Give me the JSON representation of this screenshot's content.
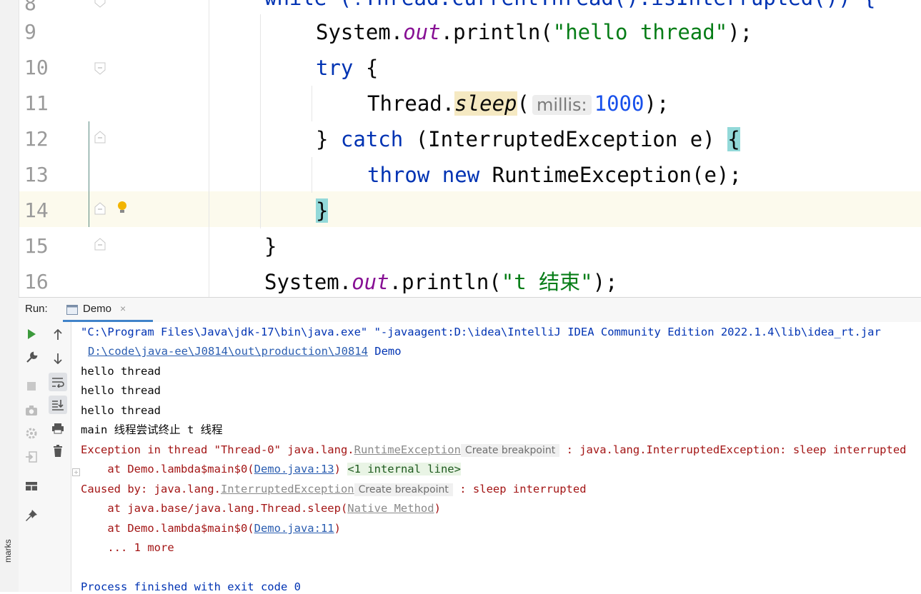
{
  "editor": {
    "line_numbers": [
      "8",
      "9",
      "10",
      "11",
      "12",
      "13",
      "14",
      "15",
      "16"
    ],
    "line8_partial": "while (!Thread.currentThread().isInterrupted()) {",
    "line9": {
      "obj": "System.",
      "field": "out",
      "call": ".println(",
      "str": "\"hello thread\"",
      "end": ");"
    },
    "line10": {
      "kw": "try",
      "rest": " {"
    },
    "line11": {
      "cls": "Thread.",
      "method": "sleep",
      "open": "(",
      "hint": "millis:",
      "num": "1000",
      "end": ");"
    },
    "line12": {
      "close": "} ",
      "kw": "catch",
      "params": " (InterruptedException e) ",
      "brace": "{"
    },
    "line13": {
      "kw1": "throw",
      "kw2": "new",
      "rest": " RuntimeException(e);"
    },
    "line14": {
      "brace": "}"
    },
    "line15": {
      "brace": "}"
    },
    "line16": {
      "obj": "System.",
      "field": "out",
      "call": ".println(",
      "str": "\"t 结束\"",
      "end": ");"
    }
  },
  "run_panel": {
    "label": "Run:",
    "tab": "Demo",
    "close": "×",
    "side_text": "marks"
  },
  "console": {
    "cmd1": "\"C:\\Program Files\\Java\\jdk-17\\bin\\java.exe\" \"-javaagent:D:\\idea\\IntelliJ IDEA Community Edition 2022.1.4\\lib\\idea_rt.jar",
    "cmd2_link": "D:\\code\\java-ee\\J0814\\out\\production\\J0814",
    "cmd2_rest": " Demo",
    "out1": "hello thread",
    "out2": "hello thread",
    "out3": "hello thread",
    "out4": "main 线程尝试终止 t 线程",
    "ex_prefix": "Exception in thread \"Thread-0\" java.lang.",
    "ex_class": "RuntimeException",
    "ex_bp": "Create breakpoint",
    "ex_msg": " : java.lang.InterruptedException: sleep interrupted",
    "at1_prefix": "    at Demo.lambda$main$0(",
    "at1_link": "Demo.java:13",
    "at1_close": ")",
    "at1_internal": "<1 internal line>",
    "cause_prefix": "Caused by: java.lang.",
    "cause_class": "InterruptedException",
    "cause_bp": "Create breakpoint",
    "cause_msg": " : sleep interrupted",
    "at2_prefix": "    at java.base/java.lang.Thread.sleep(",
    "at2_link": "Native Method",
    "at2_close": ")",
    "at3_prefix": "    at Demo.lambda$main$0(",
    "at3_link": "Demo.java:11",
    "at3_close": ")",
    "more": "    ... 1 more",
    "finished": "Process finished with exit code 0"
  },
  "icons": [
    "run-icon",
    "wrench-icon",
    "stop-icon",
    "camera-icon",
    "settings-bug-icon",
    "login-icon",
    "layout-icon",
    "pin-icon",
    "arrow-up-icon",
    "arrow-down-icon",
    "soft-wrap-icon",
    "scroll-end-icon",
    "print-icon",
    "trash-icon",
    "lightbulb-icon"
  ],
  "colors": {
    "keyword": "#0033b3",
    "string": "#067d17",
    "field": "#871094",
    "number": "#1750eb",
    "error": "#a31515",
    "run_green": "#3c9a3c"
  }
}
